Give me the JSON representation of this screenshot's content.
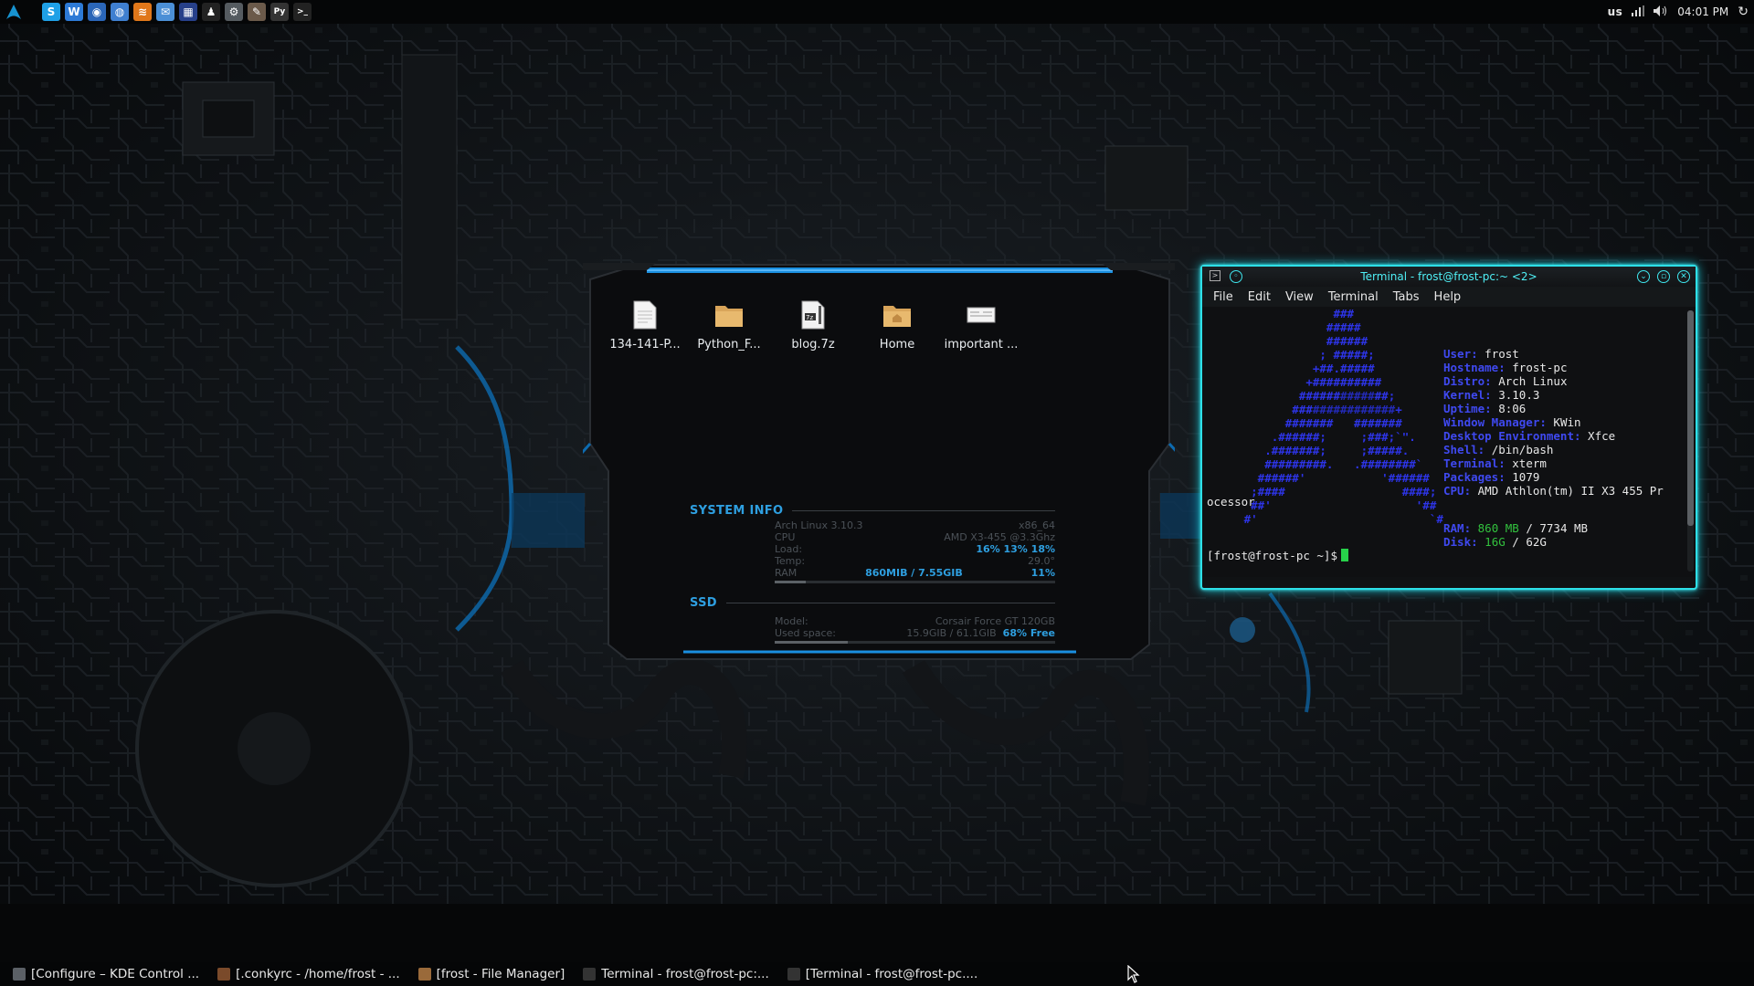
{
  "top_panel": {
    "launchers": [
      {
        "name": "skype-icon",
        "glyph": "S",
        "color": "#1fa0e6"
      },
      {
        "name": "writer-icon",
        "glyph": "W",
        "color": "#2d7ad6"
      },
      {
        "name": "browser-icon",
        "glyph": "◉",
        "color": "#2b66b8"
      },
      {
        "name": "globe-icon",
        "glyph": "◍",
        "color": "#3f7fd0"
      },
      {
        "name": "rss-icon",
        "glyph": "≋",
        "color": "#e0771a"
      },
      {
        "name": "mail-icon",
        "glyph": "✉",
        "color": "#4b8fd6"
      },
      {
        "name": "apps-icon",
        "glyph": "▦",
        "color": "#27408a"
      },
      {
        "name": "tux-icon",
        "glyph": "♟",
        "color": "#222222"
      },
      {
        "name": "settings-icon",
        "glyph": "⚙",
        "color": "#555b60"
      },
      {
        "name": "gimp-icon",
        "glyph": "✎",
        "color": "#6b5a4a"
      },
      {
        "name": "python-icon",
        "glyph": "Py",
        "color": "#333333"
      },
      {
        "name": "terminal-icon",
        "glyph": ">_",
        "color": "#222222"
      }
    ],
    "keyboard_layout": "us",
    "clock": "04:01 PM"
  },
  "desktop": {
    "items": [
      {
        "label": "134-141-P...",
        "icon": "document-icon"
      },
      {
        "label": "Python_F...",
        "icon": "folder-icon"
      },
      {
        "label": "blog.7z",
        "icon": "archive-icon"
      },
      {
        "label": "Home",
        "icon": "home-folder-icon"
      },
      {
        "label": "important ...",
        "icon": "document-icon"
      }
    ]
  },
  "conky": {
    "system_info_title": "SYSTEM INFO",
    "os": "Arch Linux 3.10.3",
    "arch": "x86_64",
    "cpu_label": "CPU",
    "cpu_model": "AMD X3-455 @3.3Ghz",
    "load_label": "Load:",
    "load_values": "16% 13% 18%",
    "temp_label": "Temp:",
    "temp_value": "29.0°",
    "ram_label": "RAM",
    "ram_value": "860MIB / 7.55GIB",
    "ram_percent": "11%",
    "ram_fraction": 0.11,
    "ssd_title": "SSD",
    "model_label": "Model:",
    "model_value": "Corsair Force GT 120GB",
    "used_label": "Used space:",
    "used_value": "15.9GIB / 61.1GIB",
    "free_value": "68% Free",
    "used_fraction": 0.26
  },
  "terminal": {
    "title": "Terminal - frost@frost-pc:~ <2>",
    "menu": [
      "File",
      "Edit",
      "View",
      "Terminal",
      "Tabs",
      "Help"
    ],
    "info": [
      {
        "key": "User:",
        "value": "frost"
      },
      {
        "key": "Hostname:",
        "value": "frost-pc"
      },
      {
        "key": "Distro:",
        "value": "Arch Linux"
      },
      {
        "key": "Kernel:",
        "value": "3.10.3"
      },
      {
        "key": "Uptime:",
        "value": "8:06"
      },
      {
        "key": "Window Manager:",
        "value": "KWin"
      },
      {
        "key": "Desktop Environment:",
        "value": "Xfce"
      },
      {
        "key": "Shell:",
        "value": "/bin/bash"
      },
      {
        "key": "Terminal:",
        "value": "xterm"
      },
      {
        "key": "Packages:",
        "value": "1079"
      },
      {
        "key": "CPU:",
        "value": "AMD Athlon(tm) II X3 455 Pr"
      }
    ],
    "wrapped_text": "ocessor",
    "ram_key": "RAM:",
    "ram_used": "860 MB",
    "ram_sep": "/ 7734 MB",
    "disk_key": "Disk:",
    "disk_used": "16G",
    "disk_sep": "/ 62G",
    "prompt": "[frost@frost-pc ~]$"
  },
  "taskbar": {
    "tasks": [
      {
        "label": "[Configure – KDE Control ...",
        "icon": "kde-control-icon",
        "color": "#5b6066"
      },
      {
        "label": "[.conkyrc - /home/frost - ...",
        "icon": "text-editor-icon",
        "color": "#7a4a2a"
      },
      {
        "label": "[frost - File Manager]",
        "icon": "file-manager-icon",
        "color": "#9a6a3a"
      },
      {
        "label": "Terminal - frost@frost-pc:...",
        "icon": "terminal-icon",
        "color": "#333"
      },
      {
        "label": "[Terminal - frost@frost-pc....",
        "icon": "terminal-icon",
        "color": "#333"
      }
    ]
  },
  "colors": {
    "accent_cyan": "#2de0e8",
    "accent_blue": "#2e9fe0",
    "neofetch_blue": "#2d34e6",
    "prompt_cursor": "#27d24a"
  }
}
